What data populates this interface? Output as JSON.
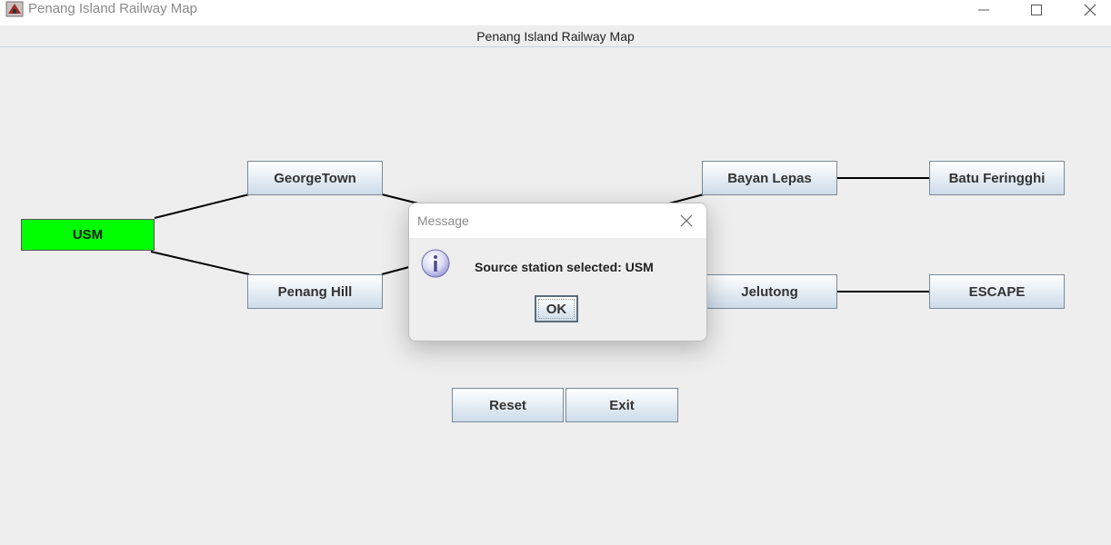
{
  "window": {
    "title": "Penang Island Railway Map",
    "icons": {
      "app": "railway-app-icon",
      "minimize": "minimize-icon",
      "maximize": "maximize-icon",
      "close": "close-icon"
    }
  },
  "map": {
    "heading": "Penang Island Railway Map",
    "stations": {
      "usm": {
        "label": "USM",
        "state": "selected",
        "color": "#00ff00"
      },
      "georgetown": {
        "label": "GeorgeTown"
      },
      "penang_hill": {
        "label": "Penang Hill"
      },
      "bayan_lepas": {
        "label": "Bayan Lepas"
      },
      "batu_feringghi": {
        "label": "Batu Feringghi"
      },
      "jelutong": {
        "label": "Jelutong"
      },
      "escape": {
        "label": "ESCAPE"
      }
    },
    "connections": [
      [
        "USM",
        "GeorgeTown"
      ],
      [
        "USM",
        "Penang Hill"
      ],
      [
        "Bayan Lepas",
        "Batu Feringghi"
      ],
      [
        "Jelutong",
        "ESCAPE"
      ]
    ]
  },
  "controls": {
    "reset_label": "Reset",
    "exit_label": "Exit"
  },
  "dialog": {
    "title": "Message",
    "message": "Source station selected: USM",
    "ok_label": "OK",
    "icons": {
      "info": "information-icon",
      "close": "close-icon"
    }
  },
  "colors": {
    "selected_station": "#00ff00",
    "button_border": "#7a8a99",
    "background": "#eeeeee"
  }
}
